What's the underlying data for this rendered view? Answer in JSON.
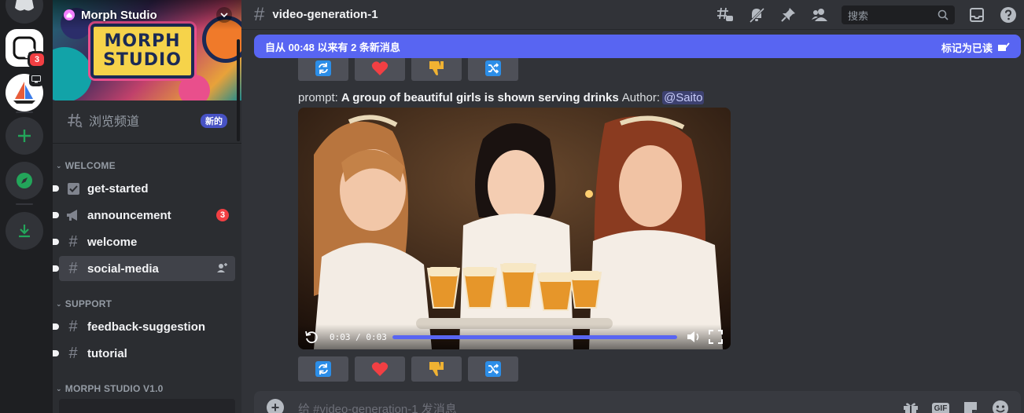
{
  "server": {
    "name": "Morph Studio",
    "banner_line1": "MORPH",
    "banner_line2": "STUDIO",
    "rail_badge": "3"
  },
  "sidebar": {
    "browse_label": "浏览频道",
    "browse_badge": "新的",
    "categories": [
      {
        "name": "WELCOME"
      },
      {
        "name": "SUPPORT"
      },
      {
        "name": "MORPH STUDIO V1.0"
      }
    ],
    "channels": [
      {
        "label": "get-started",
        "icon": "rules-icon"
      },
      {
        "label": "announcement",
        "icon": "megaphone-icon",
        "badge": "3"
      },
      {
        "label": "welcome",
        "icon": "hash-icon"
      },
      {
        "label": "social-media",
        "icon": "hash-icon"
      },
      {
        "label": "feedback-suggestion",
        "icon": "hash-icon"
      },
      {
        "label": "tutorial",
        "icon": "hash-icon"
      }
    ]
  },
  "header": {
    "channel": "video-generation-1",
    "search_placeholder": "搜索"
  },
  "newbar": {
    "text": "自从 00:48 以来有 2 条新消息",
    "mark_label": "标记为已读"
  },
  "message": {
    "prompt_label": "prompt:",
    "prompt_text": "A group of beautiful girls is shown serving drinks",
    "author_label": "Author:",
    "author_mention": "@Saito",
    "video_time": "0:03 / 0:03",
    "video_progress": 1.0
  },
  "reactions": [
    "refresh-icon",
    "heart-icon",
    "thumbs-down-icon",
    "shuffle-icon"
  ],
  "composer": {
    "placeholder": "给 #video-generation-1 发消息",
    "gif_label": "GIF"
  },
  "colors": {
    "accent": "#5865f2",
    "danger": "#f23f43",
    "heart": "#f23f43",
    "thumb": "#f0b232",
    "blue_btn": "#2c8ee8"
  }
}
